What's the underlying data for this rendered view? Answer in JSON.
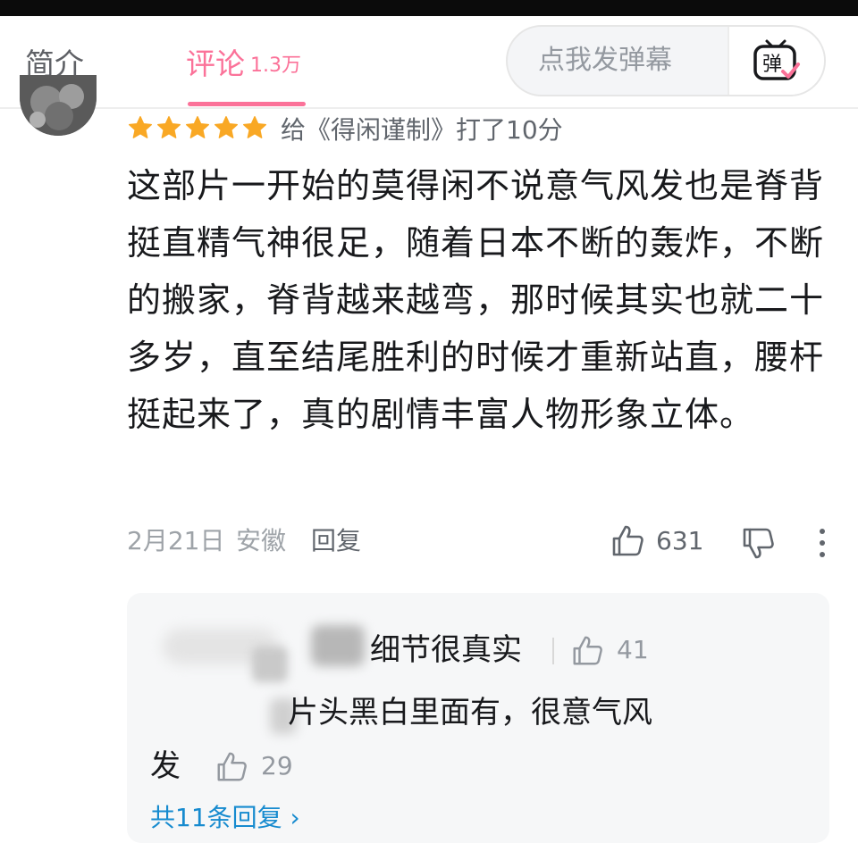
{
  "tabs": {
    "intro_label": "简介",
    "comments_label": "评论",
    "comments_count": "1.3万"
  },
  "danmaku": {
    "placeholder": "点我发弹幕",
    "button_icon": "danmaku-icon",
    "button_glyph": "弹"
  },
  "comment": {
    "rating_stars": 5,
    "rating_text": "给《得闲谨制》打了10分",
    "body": "这部片一开始的莫得闲不说意气风发也是脊背挺直精气神很足，随着日本不断的轰炸，不断的搬家，脊背越来越弯，那时候其实也就二十多岁，直至结尾胜利的时候才重新站直，腰杆挺起来了，真的剧情丰富人物形象立体。",
    "date": "2月21日",
    "location": "安徽",
    "reply_label": "回复",
    "like_count": "631"
  },
  "reply": {
    "line1": "细节很真实",
    "like1": "41",
    "line2": "片头黑白里面有，很意气风",
    "line3": "发",
    "like2": "29",
    "total_replies": "共11条回复 ›"
  },
  "colors": {
    "accent": "#fb7299",
    "star": "#f9a825",
    "link": "#178bcf"
  },
  "icons": [
    "danmaku-icon",
    "star-icon",
    "thumbs-up-icon",
    "thumbs-down-icon",
    "more-vertical-icon",
    "chevron-right-icon"
  ]
}
